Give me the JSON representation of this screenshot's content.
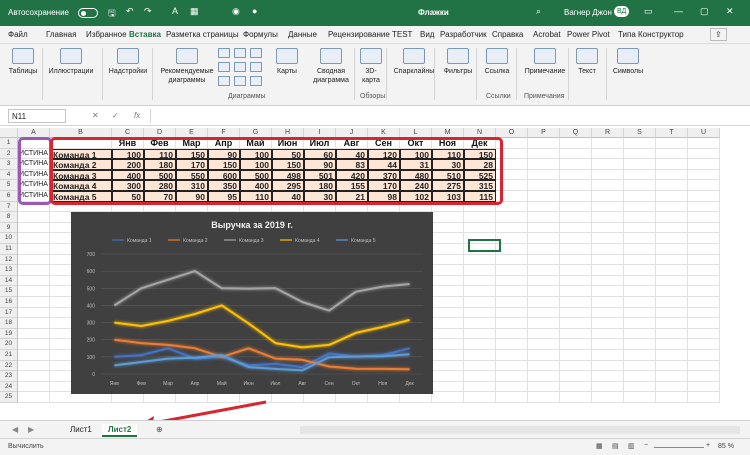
{
  "titlebar": {
    "autosave": "Автосохранение",
    "filename": "Флажки",
    "user": "Вагнер Джон",
    "initials": "ВД"
  },
  "ribbon_tabs": [
    "Файл",
    "Главная",
    "Избранное",
    "Вставка",
    "Разметка страницы",
    "Формулы",
    "Данные",
    "Рецензирование",
    "TEST",
    "Вид",
    "Разработчик",
    "Справка",
    "Acrobat",
    "Power Pivot",
    "Типа Конструктор"
  ],
  "ribbon_buttons": [
    "Таблицы",
    "Иллюстрации",
    "Надстройки",
    "Рекомендуемые диаграммы",
    "Карты",
    "Сводная диаграмма",
    "3D-карта",
    "Спарклайны",
    "Фильтры",
    "Ссылка",
    "Примечание",
    "Текст",
    "Символы"
  ],
  "ribbon_groups": [
    "Диаграммы",
    "Обзоры",
    "Ссылки",
    "Примечания"
  ],
  "formula_bar": {
    "namebox": "N11",
    "fx": "fx",
    "value": ""
  },
  "columns": [
    "A",
    "B",
    "C",
    "D",
    "E",
    "F",
    "G",
    "H",
    "I",
    "J",
    "K",
    "L",
    "M",
    "N",
    "O",
    "P",
    "Q",
    "R",
    "S",
    "T",
    "U"
  ],
  "rows": [
    "1",
    "2",
    "3",
    "4",
    "5",
    "6",
    "7",
    "8",
    "9",
    "10",
    "11",
    "12",
    "13",
    "14",
    "15",
    "16",
    "17",
    "18",
    "19",
    "20",
    "21",
    "22",
    "23",
    "24",
    "25"
  ],
  "months": [
    "Янв",
    "Фев",
    "Мар",
    "Апр",
    "Май",
    "Июн",
    "Июл",
    "Авг",
    "Сен",
    "Окт",
    "Ноя",
    "Дек"
  ],
  "bool_col": [
    "ИСТИНА",
    "ИСТИНА",
    "ИСТИНА",
    "ИСТИНА",
    "ИСТИНА"
  ],
  "teams": [
    {
      "name": "Команда 1",
      "values": [
        100,
        110,
        150,
        90,
        100,
        50,
        60,
        40,
        120,
        100,
        110,
        150
      ]
    },
    {
      "name": "Команда 2",
      "values": [
        200,
        180,
        170,
        150,
        100,
        150,
        90,
        83,
        44,
        31,
        30,
        28
      ]
    },
    {
      "name": "Команда 3",
      "values": [
        400,
        500,
        550,
        600,
        500,
        498,
        501,
        420,
        370,
        480,
        510,
        525
      ]
    },
    {
      "name": "Команда 4",
      "values": [
        300,
        280,
        310,
        350,
        400,
        295,
        180,
        155,
        170,
        240,
        275,
        315
      ]
    },
    {
      "name": "Команда 5",
      "values": [
        50,
        70,
        90,
        95,
        110,
        40,
        30,
        21,
        98,
        102,
        103,
        115
      ]
    }
  ],
  "chart_data": {
    "type": "line",
    "title": "Выручка за 2019 г.",
    "categories": [
      "Янв",
      "Фев",
      "Мар",
      "Апр",
      "Май",
      "Июн",
      "Июл",
      "Авг",
      "Сен",
      "Окт",
      "Ноя",
      "Дек"
    ],
    "ylim": [
      0,
      700
    ],
    "yticks": [
      "0",
      "100",
      "200",
      "300",
      "400",
      "500",
      "600",
      "700"
    ],
    "legend": "top",
    "series": [
      {
        "name": "Команда 1",
        "color": "#4472c4",
        "values": [
          100,
          110,
          150,
          90,
          100,
          50,
          60,
          40,
          120,
          100,
          110,
          150
        ]
      },
      {
        "name": "Команда 2",
        "color": "#ed7d31",
        "values": [
          200,
          180,
          170,
          150,
          100,
          150,
          90,
          83,
          44,
          31,
          30,
          28
        ]
      },
      {
        "name": "Команда 3",
        "color": "#a5a5a5",
        "values": [
          400,
          500,
          550,
          600,
          500,
          498,
          501,
          420,
          370,
          480,
          510,
          525
        ]
      },
      {
        "name": "Команда 4",
        "color": "#ffc000",
        "values": [
          300,
          280,
          310,
          350,
          400,
          295,
          180,
          155,
          170,
          240,
          275,
          315
        ]
      },
      {
        "name": "Команда 5",
        "color": "#5b9bd5",
        "values": [
          50,
          70,
          90,
          95,
          110,
          40,
          30,
          21,
          98,
          102,
          103,
          115
        ]
      }
    ]
  },
  "sheets": [
    "Лист1",
    "Лист2"
  ],
  "status": {
    "mode": "Вычислить",
    "zoom": "85 %"
  }
}
